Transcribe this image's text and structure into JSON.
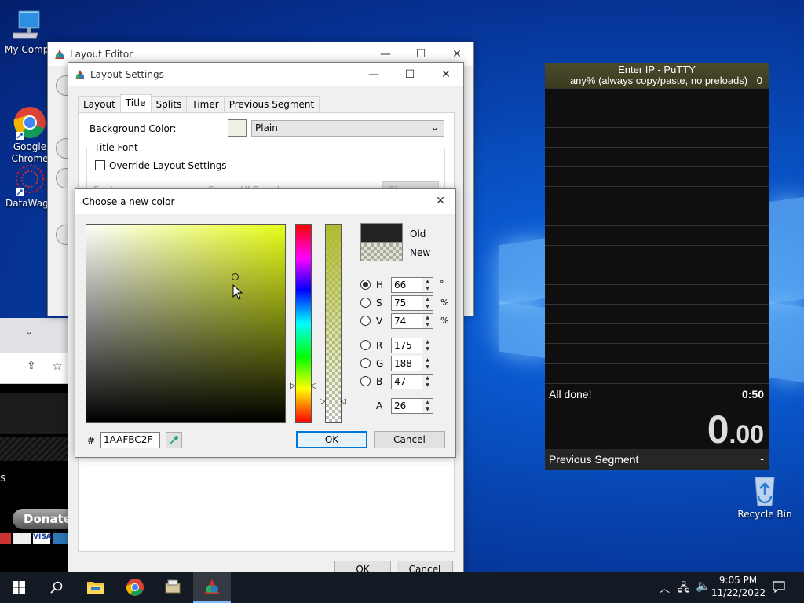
{
  "desktop": {
    "icons": [
      {
        "label": "My Compu"
      },
      {
        "label": "Google\nChrome"
      },
      {
        "label": "DataWago"
      },
      {
        "label": "Recycle Bin"
      }
    ]
  },
  "layout_editor": {
    "title": "Layout Editor"
  },
  "layout_settings": {
    "title": "Layout Settings",
    "tabs": [
      {
        "label": "Layout"
      },
      {
        "label": "Title"
      },
      {
        "label": "Splits"
      },
      {
        "label": "Timer"
      },
      {
        "label": "Previous Segment"
      }
    ],
    "background_color_label": "Background Color:",
    "background_style": "Plain",
    "title_font_group": "Title Font",
    "override_layout_label": "Override Layout Settings",
    "font_label": "Font:",
    "font_value": "Segoe UI Regular",
    "change_label": "Change...",
    "ok_label": "OK",
    "cancel_label": "Cancel"
  },
  "color_dialog": {
    "title": "Choose a new color",
    "old_label": "Old",
    "new_label": "New",
    "hsv": [
      {
        "key": "H",
        "value": "66",
        "unit": "°",
        "selected": true
      },
      {
        "key": "S",
        "value": "75",
        "unit": "%",
        "selected": false
      },
      {
        "key": "V",
        "value": "74",
        "unit": "%",
        "selected": false
      }
    ],
    "rgb": [
      {
        "key": "R",
        "value": "175"
      },
      {
        "key": "G",
        "value": "188"
      },
      {
        "key": "B",
        "value": "47"
      }
    ],
    "alpha_label": "A",
    "alpha_value": "26",
    "hash_label": "#",
    "hex_value": "1AAFBC2F",
    "ok_label": "OK",
    "cancel_label": "Cancel",
    "hue_color": "#e8ff18",
    "new_color": "#afbc2f"
  },
  "livesplit": {
    "title": "Enter IP - PuTTY",
    "category": "any% (always copy/paste, no preloads)",
    "attempts": "0",
    "split_name": "All done!",
    "split_time": "0:50",
    "timer_main": "0",
    "timer_decimals": ".00",
    "prev_segment_label": "Previous Segment",
    "prev_segment_value": "-"
  },
  "browser_fragment": {
    "donate_label": "Donate",
    "s_label": "s"
  },
  "taskbar": {
    "clock_time": "9:05 PM",
    "clock_date": "11/22/2022"
  }
}
